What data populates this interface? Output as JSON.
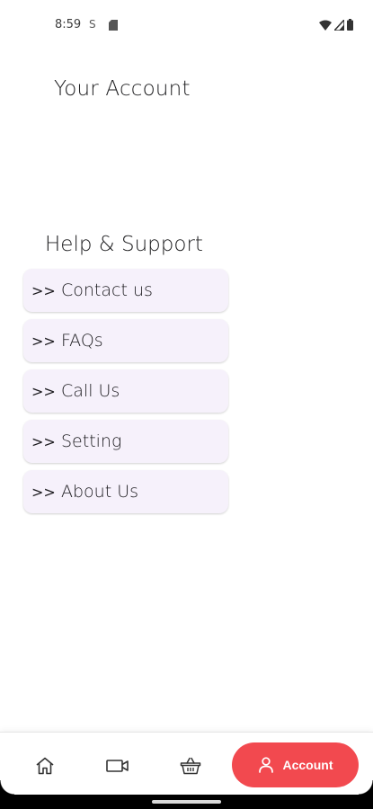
{
  "status_bar": {
    "time": "8:59",
    "s_indicator": "S"
  },
  "page_title": "Your Account",
  "help_section": {
    "title": "Help & Support",
    "items": [
      {
        "arrow": ">>",
        "label": "Contact us"
      },
      {
        "arrow": ">>",
        "label": "FAQs"
      },
      {
        "arrow": ">>",
        "label": "Call Us"
      },
      {
        "arrow": ">>",
        "label": "Setting"
      },
      {
        "arrow": ">>",
        "label": "About Us"
      }
    ]
  },
  "bottom_nav": {
    "items": [
      {
        "icon": "home-icon"
      },
      {
        "icon": "video-icon"
      },
      {
        "icon": "basket-icon"
      },
      {
        "icon": "person-icon",
        "label": "Account",
        "active": true
      }
    ],
    "active_color": "#f2494f"
  },
  "colors": {
    "card_background": "#f6f1fb",
    "accent": "#f2494f"
  }
}
